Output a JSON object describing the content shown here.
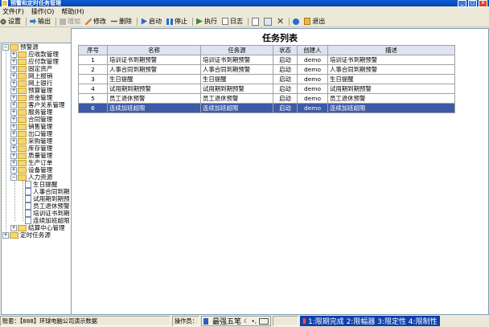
{
  "window": {
    "title": "预警和定时任务管理"
  },
  "menu": [
    "文件(F)",
    "操作(O)",
    "帮助(H)"
  ],
  "toolbar": [
    {
      "label": "设置",
      "icon": "settings-icon",
      "enabled": true
    },
    {
      "label": "输出",
      "icon": "export-icon",
      "enabled": true
    },
    {
      "label": "增加",
      "icon": "add-icon",
      "enabled": false
    },
    {
      "label": "修改",
      "icon": "edit-icon",
      "enabled": true
    },
    {
      "label": "删除",
      "icon": "delete-icon",
      "enabled": true
    },
    {
      "label": "启动",
      "icon": "start-icon",
      "enabled": true
    },
    {
      "label": "停止",
      "icon": "stop-icon",
      "enabled": true
    },
    {
      "label": "执行",
      "icon": "execute-icon",
      "enabled": true
    },
    {
      "label": "日志",
      "icon": "log-icon",
      "enabled": true
    },
    {
      "label": "退出",
      "icon": "exit-icon",
      "enabled": true
    }
  ],
  "tree": {
    "root": "预警源",
    "root_items": [
      "应收款管理",
      "应付款管理",
      "固定资产",
      "网上报销",
      "网上银行",
      "预算管理",
      "资金管理",
      "客户关系管理",
      "服务管理",
      "合同管理",
      "销售管理",
      "出口管理",
      "采购管理",
      "库存管理",
      "质量管理",
      "生产订单",
      "设备管理",
      "人力资源"
    ],
    "hr_children": [
      "生日提醒",
      "人事合同到期",
      "试用期到期预",
      "员工退休预警",
      "培训证书到期",
      "连续加班超限"
    ],
    "last_item": "结算中心管理",
    "second_root": "定时任务源"
  },
  "main": {
    "title": "任务列表",
    "columns": [
      "序号",
      "名称",
      "任务源",
      "状态",
      "创建人",
      "描述"
    ],
    "rows": [
      [
        "1",
        "培训证书到期预警",
        "培训证书到期预警",
        "启动",
        "demo",
        "培训证书到期预警"
      ],
      [
        "2",
        "人事合同到期预警",
        "人事合同到期预警",
        "启动",
        "demo",
        "人事合同到期预警"
      ],
      [
        "3",
        "生日提醒",
        "生日提醒",
        "启动",
        "demo",
        "生日提醒"
      ],
      [
        "4",
        "试用期到期预警",
        "试用期到期预警",
        "启动",
        "demo",
        "试用期到期预警"
      ],
      [
        "5",
        "员工退休预警",
        "员工退休预警",
        "启动",
        "demo",
        "员工退休预警"
      ],
      [
        "6",
        "连续加班超限",
        "连续加班超限",
        "启动",
        "demo",
        "连续加班超限"
      ]
    ],
    "selected_row": 5
  },
  "status": {
    "account": "账套：【888】环球电脑公司演示数据",
    "operator": "操作员：",
    "ime_name": "最强五笔",
    "hint": "1:限期完成 2:限幅器 3:限定性 4:限制性"
  },
  "colors": {
    "titlebar": "#0a5fd8",
    "selected_row": "#3d5aa8",
    "header_bg": "#dfe3f0"
  }
}
